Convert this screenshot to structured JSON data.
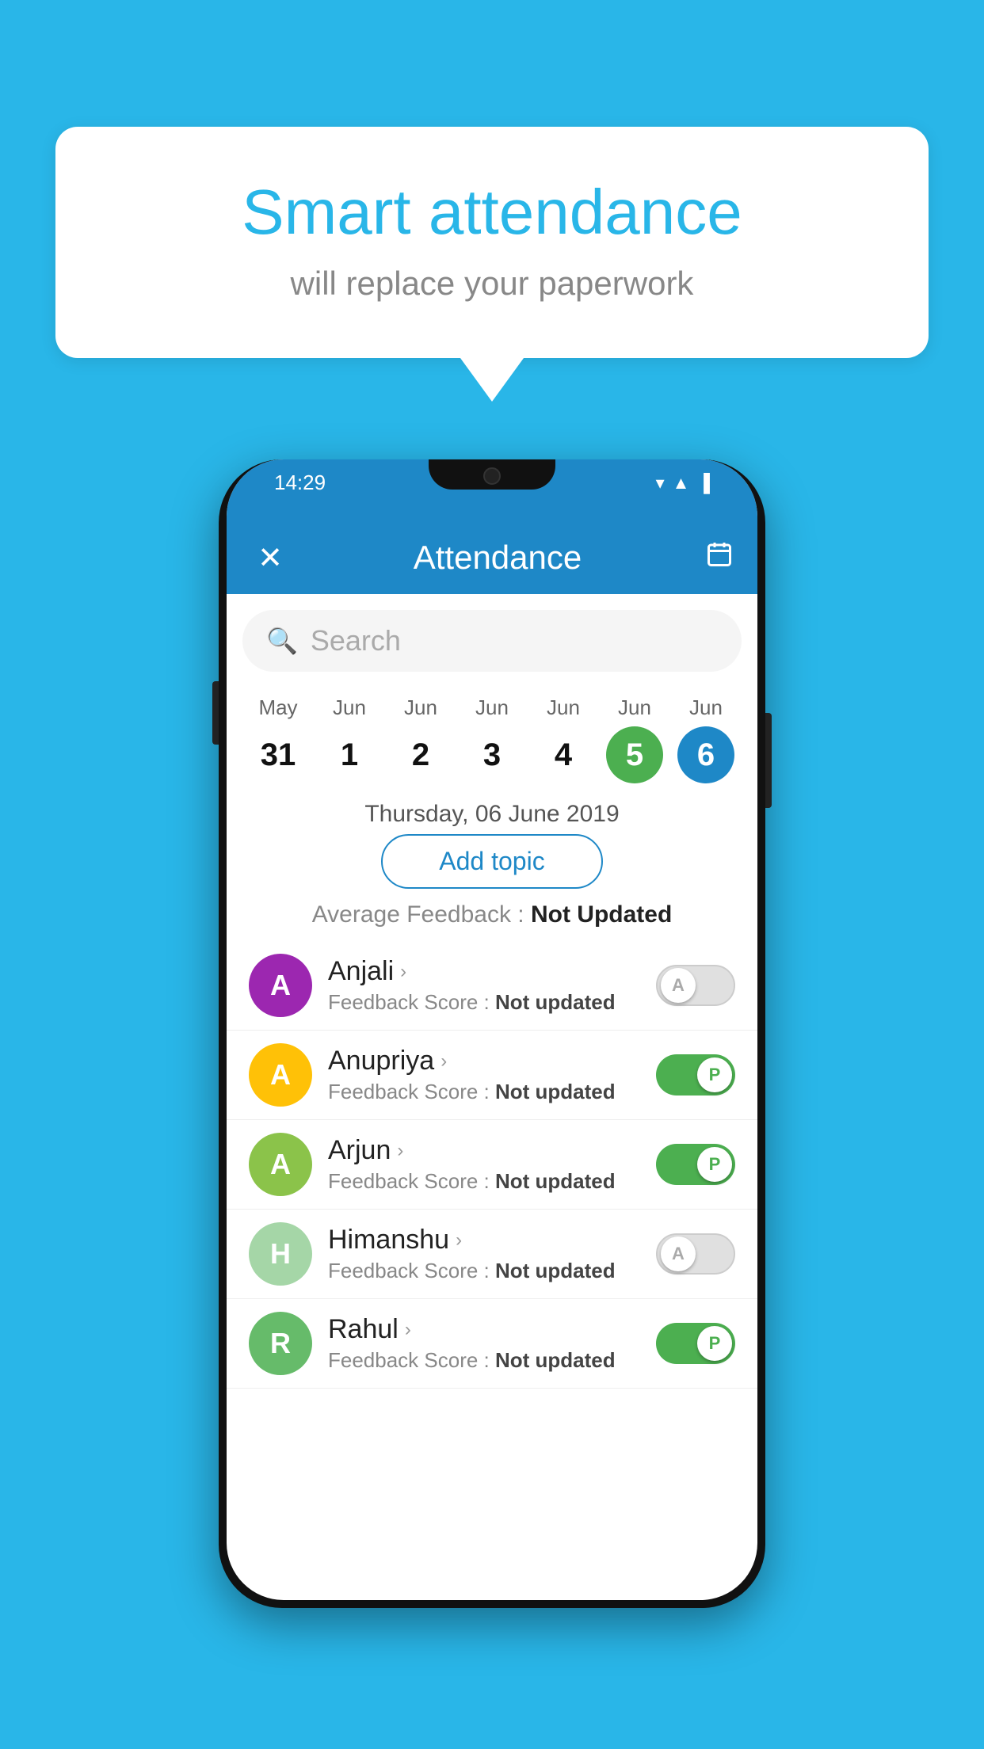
{
  "background_color": "#29B6E8",
  "speech_bubble": {
    "title": "Smart attendance",
    "subtitle": "will replace your paperwork"
  },
  "app": {
    "status_bar": {
      "time": "14:29",
      "icons": [
        "▲",
        "▲",
        "▐"
      ]
    },
    "header": {
      "title": "Attendance",
      "close_label": "✕",
      "calendar_icon": "📅"
    },
    "search": {
      "placeholder": "Search"
    },
    "calendar": {
      "days": [
        {
          "month": "May",
          "date": "31",
          "state": "normal"
        },
        {
          "month": "Jun",
          "date": "1",
          "state": "normal"
        },
        {
          "month": "Jun",
          "date": "2",
          "state": "normal"
        },
        {
          "month": "Jun",
          "date": "3",
          "state": "normal"
        },
        {
          "month": "Jun",
          "date": "4",
          "state": "normal"
        },
        {
          "month": "Jun",
          "date": "5",
          "state": "today"
        },
        {
          "month": "Jun",
          "date": "6",
          "state": "selected"
        }
      ]
    },
    "selected_date": "Thursday, 06 June 2019",
    "add_topic_label": "Add topic",
    "avg_feedback_label": "Average Feedback :",
    "avg_feedback_value": "Not Updated",
    "students": [
      {
        "name": "Anjali",
        "feedback_label": "Feedback Score :",
        "feedback_value": "Not updated",
        "avatar_letter": "A",
        "avatar_color": "#9C27B0",
        "toggle_state": "off",
        "toggle_letter": "A"
      },
      {
        "name": "Anupriya",
        "feedback_label": "Feedback Score :",
        "feedback_value": "Not updated",
        "avatar_letter": "A",
        "avatar_color": "#FFC107",
        "toggle_state": "on",
        "toggle_letter": "P"
      },
      {
        "name": "Arjun",
        "feedback_label": "Feedback Score :",
        "feedback_value": "Not updated",
        "avatar_letter": "A",
        "avatar_color": "#8BC34A",
        "toggle_state": "on",
        "toggle_letter": "P"
      },
      {
        "name": "Himanshu",
        "feedback_label": "Feedback Score :",
        "feedback_value": "Not updated",
        "avatar_letter": "H",
        "avatar_color": "#A5D6A7",
        "toggle_state": "off",
        "toggle_letter": "A"
      },
      {
        "name": "Rahul",
        "feedback_label": "Feedback Score :",
        "feedback_value": "Not updated",
        "avatar_letter": "R",
        "avatar_color": "#66BB6A",
        "toggle_state": "on",
        "toggle_letter": "P"
      }
    ]
  }
}
